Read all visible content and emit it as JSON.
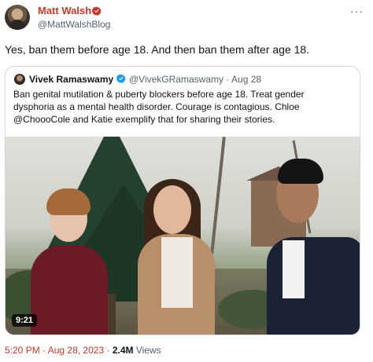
{
  "tweet": {
    "author": {
      "name": "Matt Walsh",
      "handle": "@MattWalshBlog",
      "verified_color": "#c0392b",
      "avatar_icon": "user-avatar"
    },
    "more_icon": "···",
    "text": "Yes, ban them before age 18. And then ban them after age 18.",
    "quote": {
      "author_name": "Vivek Ramaswamy",
      "handle": "@VivekGRamaswamy",
      "separator": "·",
      "date": "Aug 28",
      "verified_color": "#1d9bf0",
      "text_lines": [
        "Ban genital mutilation & puberty blockers before age 18. Treat gender",
        "dysphoria as a mental health disorder.  Courage is contagious. Chloe",
        "@ChoooCole and Katie exemplify that for sharing their stories."
      ],
      "video": {
        "duration": "9:21"
      }
    },
    "meta": {
      "time": "5:20 PM",
      "separator": "·",
      "date": "Aug 28, 2023",
      "separator2": "·",
      "views_count": "2.4M",
      "views_label": "Views"
    }
  }
}
